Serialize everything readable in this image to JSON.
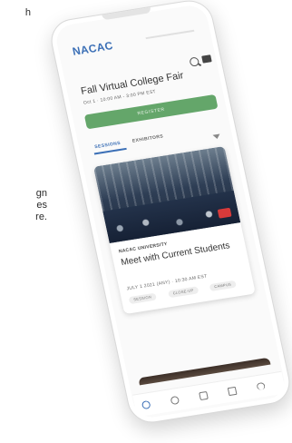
{
  "side_text": {
    "top": "h",
    "middle_lines": [
      "gn",
      "es",
      "re."
    ]
  },
  "app": {
    "logo": "NACAC"
  },
  "event": {
    "title": "Fall Virtual College Fair",
    "meta": "Oct 1 · 10:00 AM - 3:00 PM EST",
    "register_label": "REGISTER"
  },
  "tabs": [
    {
      "label": "SESSIONS",
      "active": true
    },
    {
      "label": "EXHIBITORS",
      "active": false
    }
  ],
  "session_card": {
    "org": "NACAC UNIVERSITY",
    "title": "Meet with Current Students",
    "date": "JULY 1 2021 (ANY) · 10:30 AM EST",
    "tags": [
      "SESSION",
      "CLOSE-UP",
      "CAMPUS"
    ]
  },
  "nav": {
    "items": [
      {
        "name": "home-icon",
        "active": true
      },
      {
        "name": "lock-icon",
        "active": false
      },
      {
        "name": "chat-icon",
        "active": false
      },
      {
        "name": "calendar-icon",
        "active": false
      },
      {
        "name": "person-icon",
        "active": false
      }
    ]
  },
  "colors": {
    "accent": "#3b6fb6",
    "register": "#64a66a",
    "live": "#d83a3a"
  }
}
